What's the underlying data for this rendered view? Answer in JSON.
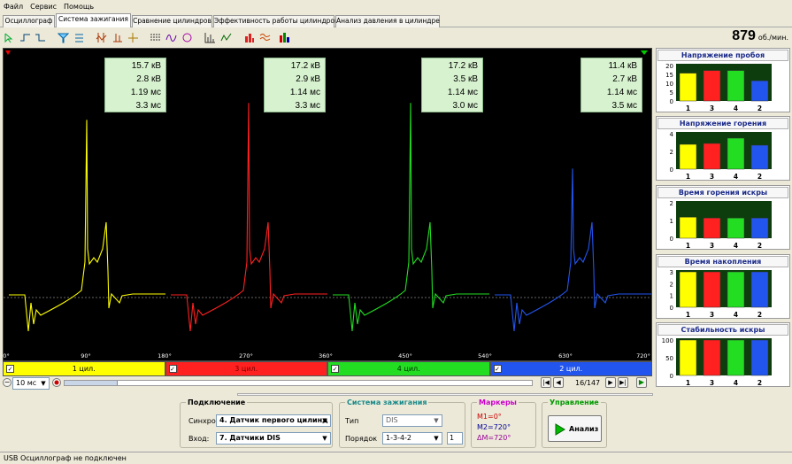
{
  "menu": [
    "Файл",
    "Сервис",
    "Помощь"
  ],
  "tabs": [
    "Осциллограф",
    "Система зажигания",
    "Сравнение цилиндров",
    "Эффективность работы цилиндров",
    "Анализ давления в цилиндре"
  ],
  "active_tab": 1,
  "rpm": {
    "value": "879",
    "unit": "об./мин."
  },
  "measurements": [
    {
      "kv1": "15.7 кВ",
      "kv2": "2.8 кВ",
      "ms1": "1.19 мс",
      "ms2": "3.3 мс"
    },
    {
      "kv1": "17.2 кВ",
      "kv2": "2.9 кВ",
      "ms1": "1.14 мс",
      "ms2": "3.3 мс"
    },
    {
      "kv1": "17.2 кВ",
      "kv2": "3.5 кВ",
      "ms1": "1.14 мс",
      "ms2": "3.0 мс"
    },
    {
      "kv1": "11.4 кВ",
      "kv2": "2.7 кВ",
      "ms1": "1.14 мс",
      "ms2": "3.5 мс"
    }
  ],
  "degree_labels": [
    "0°",
    "90°",
    "180°",
    "270°",
    "360°",
    "450°",
    "540°",
    "630°",
    "720°"
  ],
  "cylinders": [
    {
      "label": "1 цил.",
      "color": "#ffff00",
      "text": "#000000"
    },
    {
      "label": "3 цил.",
      "color": "#ff2020",
      "text": "#7a0000"
    },
    {
      "label": "4 цил.",
      "color": "#22dd22",
      "text": "#003300"
    },
    {
      "label": "2 цил.",
      "color": "#2255ee",
      "text": "#ffffff"
    }
  ],
  "timebase": "10 мс",
  "frame": "16/147",
  "side_panels": [
    {
      "title": "Напряжение пробоя",
      "ticks": [
        "20",
        "15",
        "10",
        "5",
        "0"
      ],
      "cats": [
        "1",
        "3",
        "4",
        "2"
      ],
      "values": [
        15.7,
        17.2,
        17.2,
        11.4
      ],
      "max": 20
    },
    {
      "title": "Напряжение горения",
      "ticks": [
        "4",
        "2",
        "0"
      ],
      "cats": [
        "1",
        "3",
        "4",
        "2"
      ],
      "values": [
        2.8,
        2.9,
        3.5,
        2.7
      ],
      "max": 4
    },
    {
      "title": "Время горения искры",
      "ticks": [
        "2",
        "1",
        "0"
      ],
      "cats": [
        "1",
        "3",
        "4",
        "2"
      ],
      "values": [
        1.19,
        1.14,
        1.14,
        1.14
      ],
      "max": 2
    },
    {
      "title": "Время накопления",
      "ticks": [
        "3",
        "2",
        "1",
        "0"
      ],
      "cats": [
        "1",
        "3",
        "4",
        "2"
      ],
      "values": [
        3.3,
        3.3,
        3.0,
        3.5
      ],
      "max": 3
    },
    {
      "title": "Стабильность искры",
      "ticks": [
        "100",
        "50",
        "0"
      ],
      "cats": [
        "1",
        "3",
        "4",
        "2"
      ],
      "values": [
        100,
        100,
        100,
        100
      ],
      "max": 100
    }
  ],
  "connection": {
    "title": "Подключение",
    "sync_label": "Синхро:",
    "sync_value": "4.  Датчик первого цилинд",
    "input_label": "Вход:",
    "input_value": "7.  Датчики DIS"
  },
  "ignition": {
    "title": "Система зажигания",
    "type_label": "Тип",
    "type_value": "DIS",
    "order_label": "Порядок",
    "order_value": "1-3-4-2",
    "spin": "1"
  },
  "markers": {
    "title": "Маркеры",
    "m1": "M1=0°",
    "m2": "M2=720°",
    "dm": "ΔM=720°"
  },
  "control": {
    "title": "Управление",
    "button": "Анализ"
  },
  "status": "USB Осциллограф не подключен",
  "colors": {
    "yellow": "#ffff00",
    "red": "#ff2020",
    "green": "#22dd22",
    "blue": "#2255ee"
  }
}
